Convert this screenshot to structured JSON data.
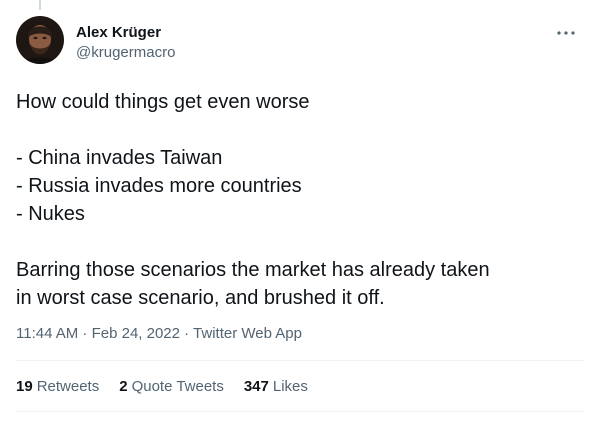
{
  "author": {
    "display_name": "Alex Krüger",
    "handle": "@krugermacro"
  },
  "tweet": {
    "lines": [
      "How could things get even worse",
      "",
      "- China invades Taiwan",
      "- Russia invades more countries",
      "- Nukes",
      "",
      "Barring those scenarios the market has already taken",
      "in worst case scenario, and brushed it off."
    ]
  },
  "meta": {
    "timestamp": "11:44 AM · Feb 24, 2022 · Twitter Web App"
  },
  "stats": {
    "retweets_count": "19",
    "retweets_label": "Retweets",
    "quote_count": "2",
    "quote_label": "Quote Tweets",
    "likes_count": "347",
    "likes_label": "Likes"
  },
  "icons": {
    "more": "more-horizontal-icon"
  }
}
